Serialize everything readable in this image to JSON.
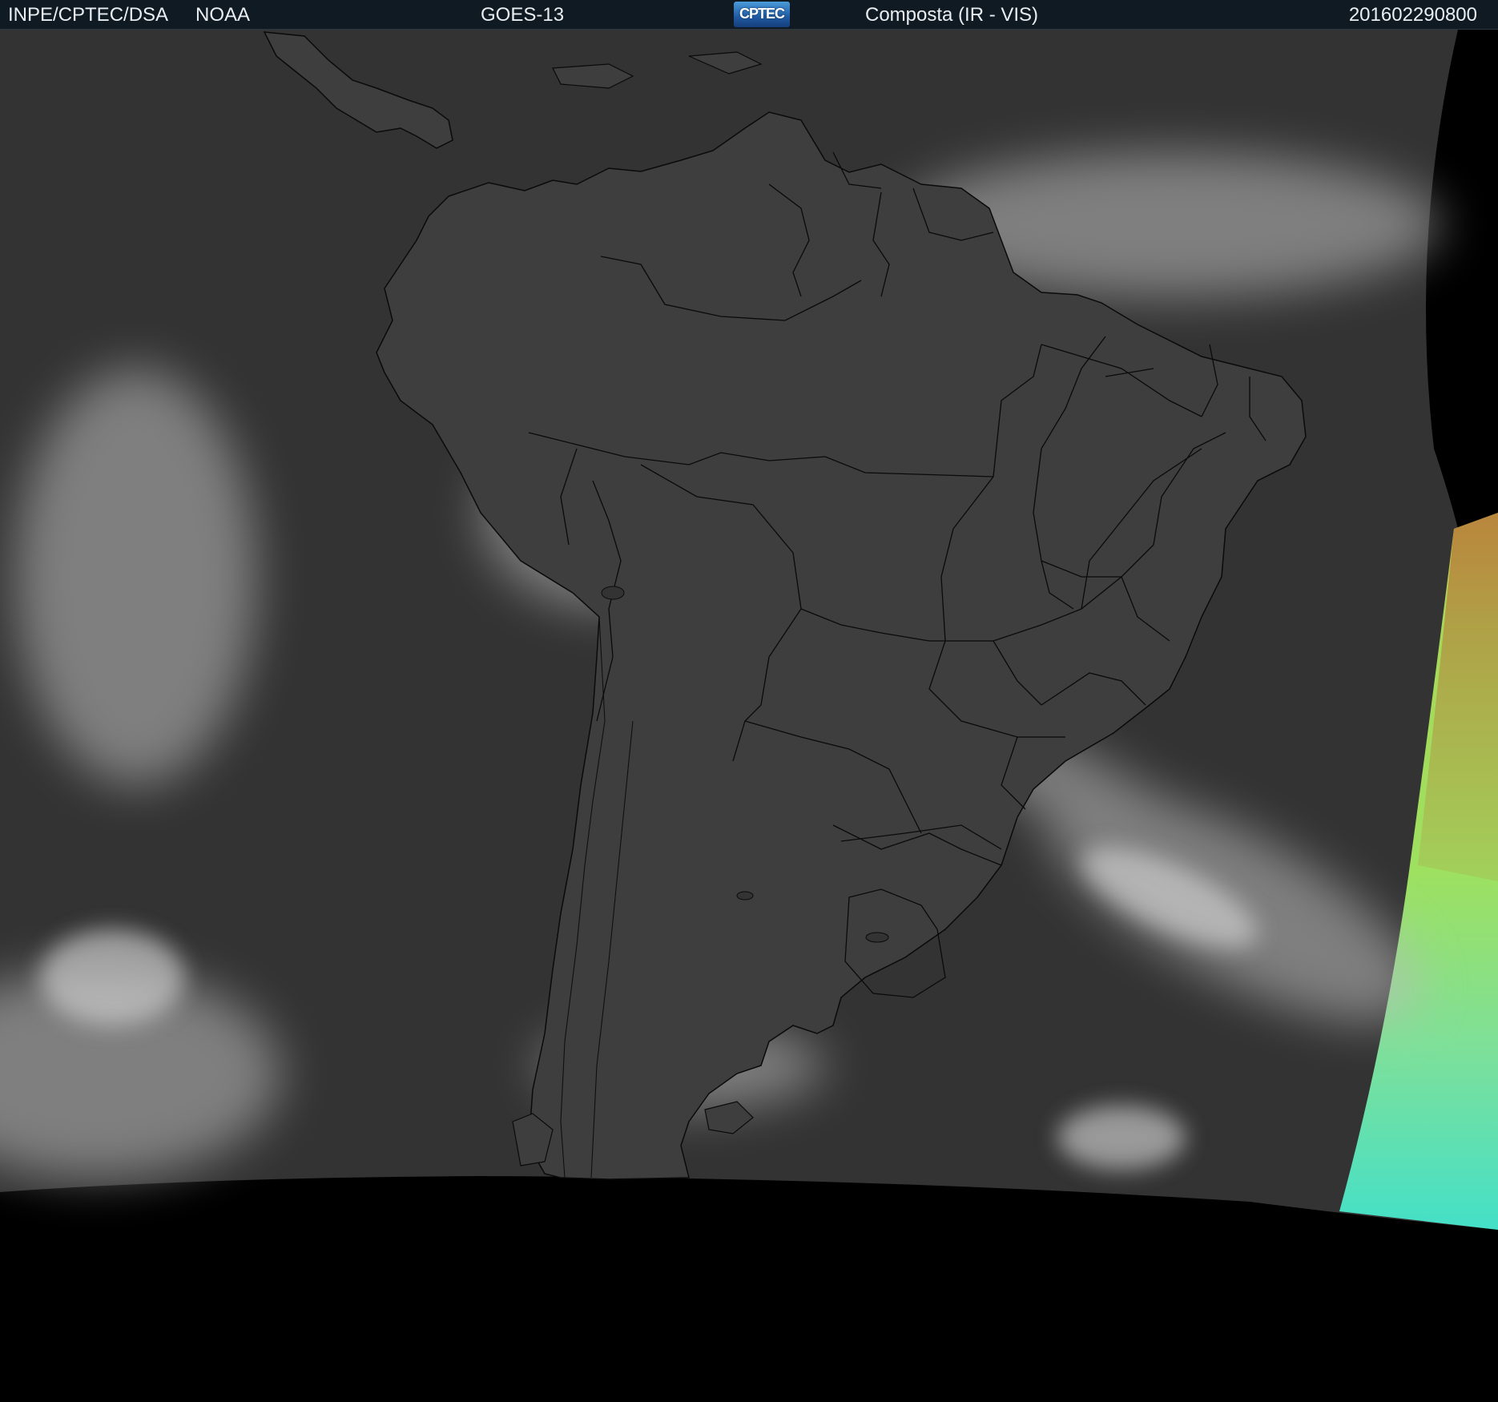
{
  "header": {
    "institution": "INPE/CPTEC/DSA",
    "agency": "NOAA",
    "satellite": "GOES-13",
    "logo_text": "CPTEC",
    "product": "Composta (IR - VIS)",
    "timestamp": "201602290800"
  },
  "imagery": {
    "region": "South America",
    "colors": {
      "ocean": "#333333",
      "land": "#3f3f3f",
      "cloud": "#cfcfcf",
      "border": "#0a0a0a",
      "no_data": "#000000",
      "vis_green": "#a8e05a",
      "vis_brown": "#b5783a",
      "vis_cyan": "#44e0c8"
    }
  }
}
